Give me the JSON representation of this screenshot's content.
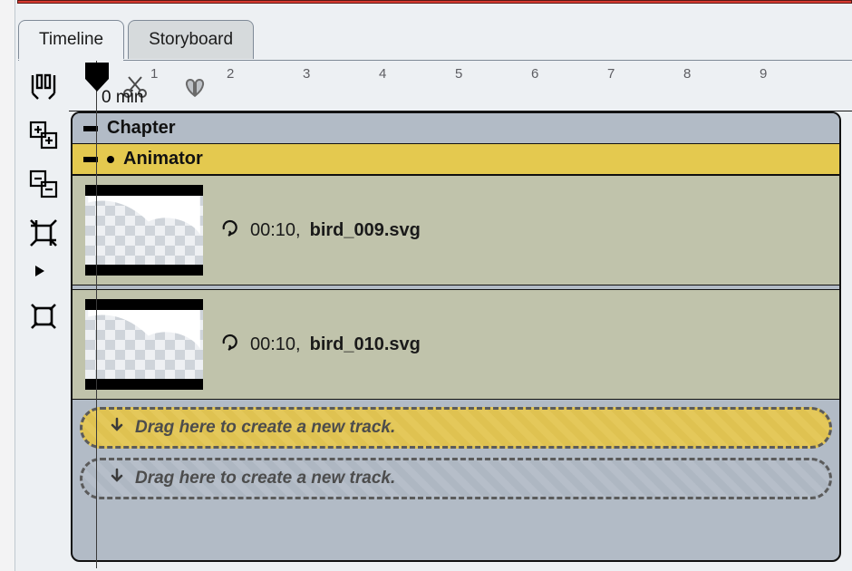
{
  "tabs": {
    "timeline": "Timeline",
    "storyboard": "Storyboard"
  },
  "ruler": {
    "zero_label": "0 min",
    "ticks": [
      "1",
      "2",
      "3",
      "4",
      "5",
      "6",
      "7",
      "8",
      "9"
    ]
  },
  "tracks": {
    "chapter_label": "Chapter",
    "animator_label": "Animator",
    "clips": [
      {
        "duration": "00:10,",
        "filename": "bird_009.svg"
      },
      {
        "duration": "00:10,",
        "filename": "bird_010.svg"
      }
    ],
    "drop_hint": "Drag here to create a new track."
  },
  "toolbar": {
    "items": [
      "snap-tool",
      "add-combo-tool",
      "remove-combo-tool",
      "crop-tool",
      "play-tool",
      "frame-bounds-tool"
    ]
  }
}
